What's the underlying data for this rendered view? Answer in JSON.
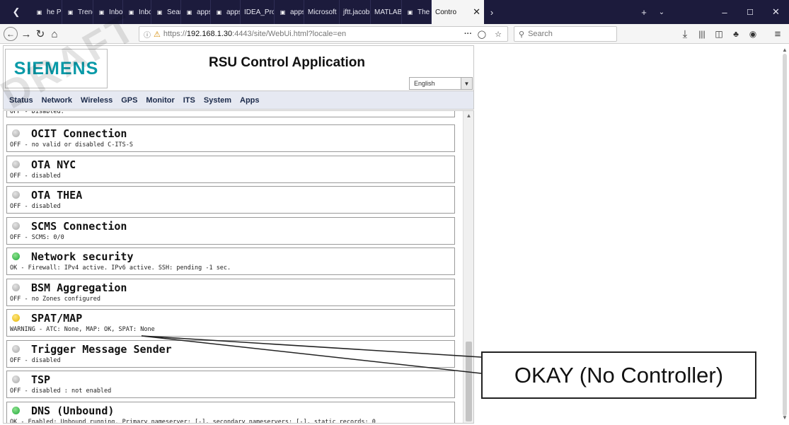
{
  "browser": {
    "tabs": [
      {
        "label": "he Pi",
        "icon": "back-arrow-icon"
      },
      {
        "label": "Trend",
        "icon": "trend-icon"
      },
      {
        "label": "Inbox",
        "icon": "mail-icon"
      },
      {
        "label": "Inbox",
        "icon": "mail-icon"
      },
      {
        "label": "Search",
        "icon": "search-drive-icon"
      },
      {
        "label": "apps.t",
        "icon": "apps-icon"
      },
      {
        "label": "apps.t",
        "icon": "apps-icon"
      },
      {
        "label": "IDEA_Prog",
        "icon": ""
      },
      {
        "label": "apps.t",
        "icon": "apps-icon"
      },
      {
        "label": "Microsoft",
        "icon": ""
      },
      {
        "label": "jftt.jacobs",
        "icon": ""
      },
      {
        "label": "MATLAB |",
        "icon": ""
      },
      {
        "label": "The C",
        "icon": "flag-icon"
      },
      {
        "label": "Contro",
        "icon": "",
        "active": true
      }
    ],
    "url": "https://192.168.1.30:4443/site/WebUi.html?locale=en",
    "url_host": "192.168.1.30",
    "url_prefix": "https://",
    "url_suffix": ":4443/site/WebUi.html?locale=en",
    "search_placeholder": "Search",
    "more_glyph": "···"
  },
  "app": {
    "logo": "SIEMENS",
    "title": "RSU Control Application",
    "language": "English",
    "menu": [
      "Status",
      "Network",
      "Wireless",
      "GPS",
      "Monitor",
      "ITS",
      "System",
      "Apps"
    ],
    "partial_top_status": "OFF - Disabled.",
    "status_items": [
      {
        "title": "OCIT Connection",
        "status": "OFF - no valid or disabled C-ITS-S",
        "state": "off"
      },
      {
        "title": "OTA NYC",
        "status": "OFF - disabled",
        "state": "off"
      },
      {
        "title": "OTA THEA",
        "status": "OFF - disabled",
        "state": "off"
      },
      {
        "title": "SCMS Connection",
        "status": "OFF - SCMS: 0/0",
        "state": "off"
      },
      {
        "title": "Network security",
        "status": "OK - Firewall: IPv4 active. IPv6 active. SSH: pending -1 sec.",
        "state": "ok"
      },
      {
        "title": "BSM Aggregation",
        "status": "OFF - no Zones configured",
        "state": "off"
      },
      {
        "title": "SPAT/MAP",
        "status": "WARNING - ATC: None, MAP: OK, SPAT: None",
        "state": "warn"
      },
      {
        "title": "Trigger Message Sender",
        "status": "OFF - disabled",
        "state": "off"
      },
      {
        "title": "TSP",
        "status": "OFF - disabled : not enabled",
        "state": "off"
      },
      {
        "title": "DNS (Unbound)",
        "status": "OK - Enabled: Unbound running. Primary nameserver: [-], secondary nameservers: [-], static records: 0",
        "state": "ok"
      }
    ]
  },
  "annotation": {
    "callout": "OKAY (No Controller)",
    "watermark": "DRAFT"
  }
}
